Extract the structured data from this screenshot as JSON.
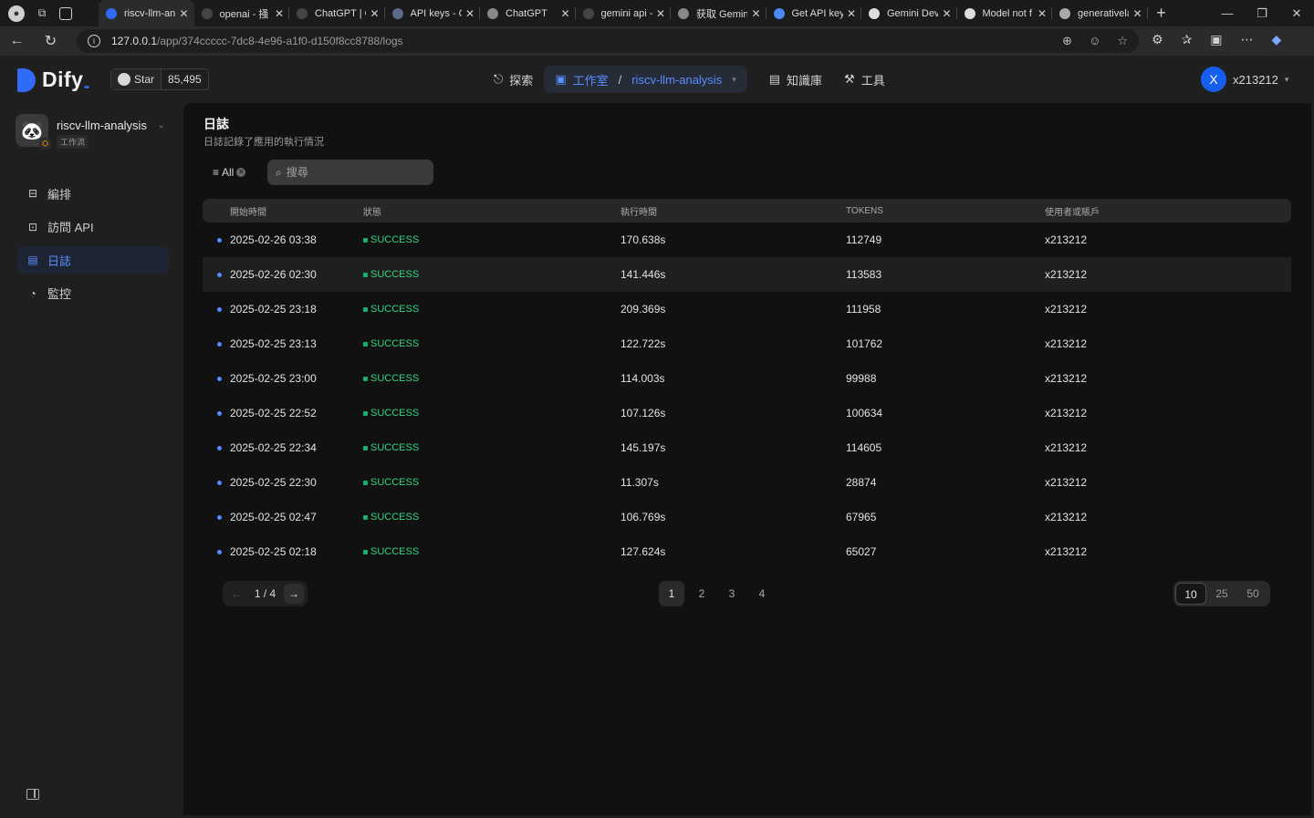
{
  "browser": {
    "tabs": [
      {
        "title": "riscv-llm-an",
        "active": true,
        "favicon_color": "#2f6bf6"
      },
      {
        "title": "openai - 掻",
        "favicon_color": "#444444"
      },
      {
        "title": "ChatGPT | O",
        "favicon_color": "#444444"
      },
      {
        "title": "API keys - O",
        "favicon_color": "#5a6a8a"
      },
      {
        "title": "ChatGPT",
        "favicon_color": "#888888"
      },
      {
        "title": "gemini api -",
        "favicon_color": "#444444"
      },
      {
        "title": "获取 Gemini",
        "favicon_color": "#888888"
      },
      {
        "title": "Get API key",
        "favicon_color": "#4a8af4"
      },
      {
        "title": "Gemini Dev",
        "favicon_color": "#dddddd"
      },
      {
        "title": "Model not f",
        "favicon_color": "#dddddd"
      },
      {
        "title": "generativela",
        "favicon_color": "#aaaaaa"
      }
    ],
    "url_host": "127.0.0.1",
    "url_path": "/app/374ccccc-7dc8-4e96-a1f0-d150f8cc8788/logs"
  },
  "header": {
    "brand": "Dify",
    "github_star_label": "Star",
    "github_star_count": "85,495",
    "nav": {
      "explore": "探索",
      "studio": "工作室",
      "current_app": "riscv-llm-analysis",
      "knowledge": "知識庫",
      "tools": "工具"
    },
    "user": {
      "initial": "X",
      "name": "x213212"
    }
  },
  "sidebar": {
    "app_name": "riscv-llm-analysis",
    "app_type": "工作流",
    "items": [
      {
        "label": "編排",
        "icon": "layout-icon",
        "active": false
      },
      {
        "label": "訪問 API",
        "icon": "terminal-icon",
        "active": false
      },
      {
        "label": "日誌",
        "icon": "file-list-icon",
        "active": true
      },
      {
        "label": "監控",
        "icon": "dashboard-icon",
        "active": false
      }
    ]
  },
  "logs": {
    "title": "日誌",
    "subtitle": "日誌記錄了應用的執行情況",
    "filter_label": "All",
    "search_placeholder": "搜尋",
    "columns": [
      "開始時間",
      "狀態",
      "執行時間",
      "TOKENS",
      "使用者或賬戶"
    ],
    "rows": [
      {
        "start": "2025-02-26 03:38",
        "status": "SUCCESS",
        "duration": "170.638s",
        "tokens": "112749",
        "user": "x213212"
      },
      {
        "start": "2025-02-26 02:30",
        "status": "SUCCESS",
        "duration": "141.446s",
        "tokens": "113583",
        "user": "x213212"
      },
      {
        "start": "2025-02-25 23:18",
        "status": "SUCCESS",
        "duration": "209.369s",
        "tokens": "111958",
        "user": "x213212"
      },
      {
        "start": "2025-02-25 23:13",
        "status": "SUCCESS",
        "duration": "122.722s",
        "tokens": "101762",
        "user": "x213212"
      },
      {
        "start": "2025-02-25 23:00",
        "status": "SUCCESS",
        "duration": "114.003s",
        "tokens": "99988",
        "user": "x213212"
      },
      {
        "start": "2025-02-25 22:52",
        "status": "SUCCESS",
        "duration": "107.126s",
        "tokens": "100634",
        "user": "x213212"
      },
      {
        "start": "2025-02-25 22:34",
        "status": "SUCCESS",
        "duration": "145.197s",
        "tokens": "114605",
        "user": "x213212"
      },
      {
        "start": "2025-02-25 22:30",
        "status": "SUCCESS",
        "duration": "11.307s",
        "tokens": "28874",
        "user": "x213212"
      },
      {
        "start": "2025-02-25 02:47",
        "status": "SUCCESS",
        "duration": "106.769s",
        "tokens": "67965",
        "user": "x213212"
      },
      {
        "start": "2025-02-25 02:18",
        "status": "SUCCESS",
        "duration": "127.624s",
        "tokens": "65027",
        "user": "x213212"
      }
    ],
    "pagination": {
      "current_of_total": "1 / 4",
      "pages": [
        "1",
        "2",
        "3",
        "4"
      ],
      "current_page": "1",
      "page_sizes": [
        "10",
        "25",
        "50"
      ],
      "current_size": "10"
    }
  },
  "colors": {
    "accent": "#155eef",
    "status_success": "#17b26a",
    "panel_bg": "#111111"
  }
}
